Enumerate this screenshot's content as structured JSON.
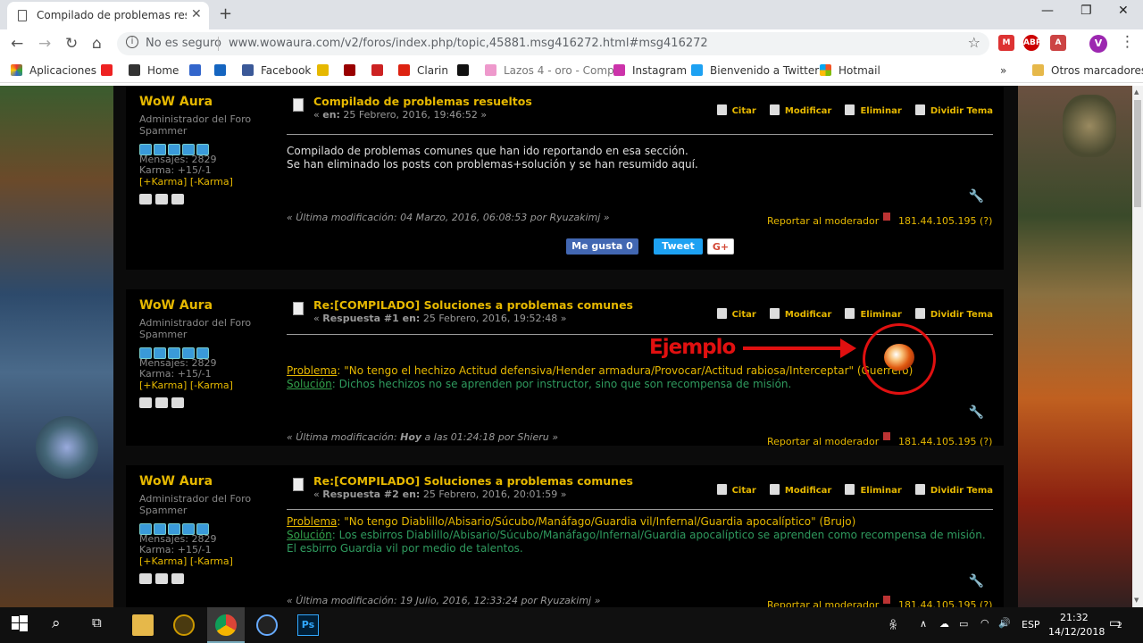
{
  "browser": {
    "tab_title": "Compilado de problemas resuelt",
    "security": "No es seguro",
    "url": "www.wowaura.com/v2/foros/index.php/topic,45881.msg416272.html#msg416272"
  },
  "bookmarks": {
    "items": [
      "Aplicaciones",
      "Home",
      "Facebook",
      "Clarin",
      "Lazos 4 - oro - Comp",
      "Instagram",
      "Bienvenido a Twitter",
      "Hotmail"
    ],
    "other": "Otros marcadores"
  },
  "posts": [
    {
      "author": "WoW Aura",
      "rank": "Administrador del Foro",
      "group": "Spammer",
      "messages": "Mensajes: 2829",
      "karma": "Karma: +15/-1",
      "karma_links": "[+Karma] [-Karma]",
      "title": "Compilado de problemas resueltos",
      "date_prefix": "« ",
      "date_label": "en:",
      "date": " 25 Febrero, 2016, 19:46:52 »",
      "body_line1": "Compilado de problemas comunes que han ido reportando en esa sección.",
      "body_line2": "Se han eliminado los posts con problemas+solución y se han resumido aquí.",
      "last_mod": "« Última modificación: 04 Marzo, 2016, 06:08:53 por Ryuzakimj »",
      "report": "Reportar al moderador",
      "ip": "181.44.105.195 (?)",
      "like": "Me gusta 0",
      "tweet": "Tweet",
      "gplus": "G+"
    },
    {
      "author": "WoW Aura",
      "rank": "Administrador del Foro",
      "group": "Spammer",
      "messages": "Mensajes: 2829",
      "karma": "Karma: +15/-1",
      "karma_links": "[+Karma] [-Karma]",
      "title": "Re:[COMPILADO] Soluciones a problemas comunes",
      "date_prefix": "« ",
      "date_label": "Respuesta #1 en:",
      "date": " 25 Febrero, 2016, 19:52:48 »",
      "problem_label": "Problema",
      "problem": ": \"No tengo el hechizo Actitud defensiva/Hender armadura/Provocar/Actitud rabiosa/Interceptar\" (Guerrero)",
      "solution_label": "Solución",
      "solution": ": Dichos hechizos no se aprenden por instructor, sino que son recompensa de misión.",
      "last_mod_a": "« Última modificación: ",
      "last_mod_b": "Hoy",
      "last_mod_c": " a las 01:24:18 por Shieru »",
      "report": "Reportar al moderador",
      "ip": "181.44.105.195 (?)"
    },
    {
      "author": "WoW Aura",
      "rank": "Administrador del Foro",
      "group": "Spammer",
      "messages": "Mensajes: 2829",
      "karma": "Karma: +15/-1",
      "karma_links": "[+Karma] [-Karma]",
      "title": "Re:[COMPILADO] Soluciones a problemas comunes",
      "date_prefix": "« ",
      "date_label": "Respuesta #2 en:",
      "date": " 25 Febrero, 2016, 20:01:59 »",
      "problem_label": "Problema",
      "problem": ": \"No tengo Diablillo/Abisario/Súcubo/Manáfago/Guardia vil/Infernal/Guardia apocalíptico\" (Brujo)",
      "solution_label": "Solución",
      "solution": ": Los esbirros Diablillo/Abisario/Súcubo/Manáfago/Infernal/Guardia apocalíptico se aprenden como recompensa de misión.",
      "solution2": "El esbirro Guardia vil por medio de talentos.",
      "last_mod": "« Última modificación: 19 Julio, 2016, 12:33:24 por Ryuzakimj »",
      "report": "Reportar al moderador",
      "ip": "181.44.105.195 (?)"
    }
  ],
  "actions": {
    "quote": "Citar",
    "edit": "Modificar",
    "delete": "Eliminar",
    "split": "Dividir Tema"
  },
  "annotation": "Ejemplo",
  "taskbar": {
    "lang": "ESP",
    "time": "21:32",
    "date": "14/12/2018",
    "notif_count": "2"
  }
}
